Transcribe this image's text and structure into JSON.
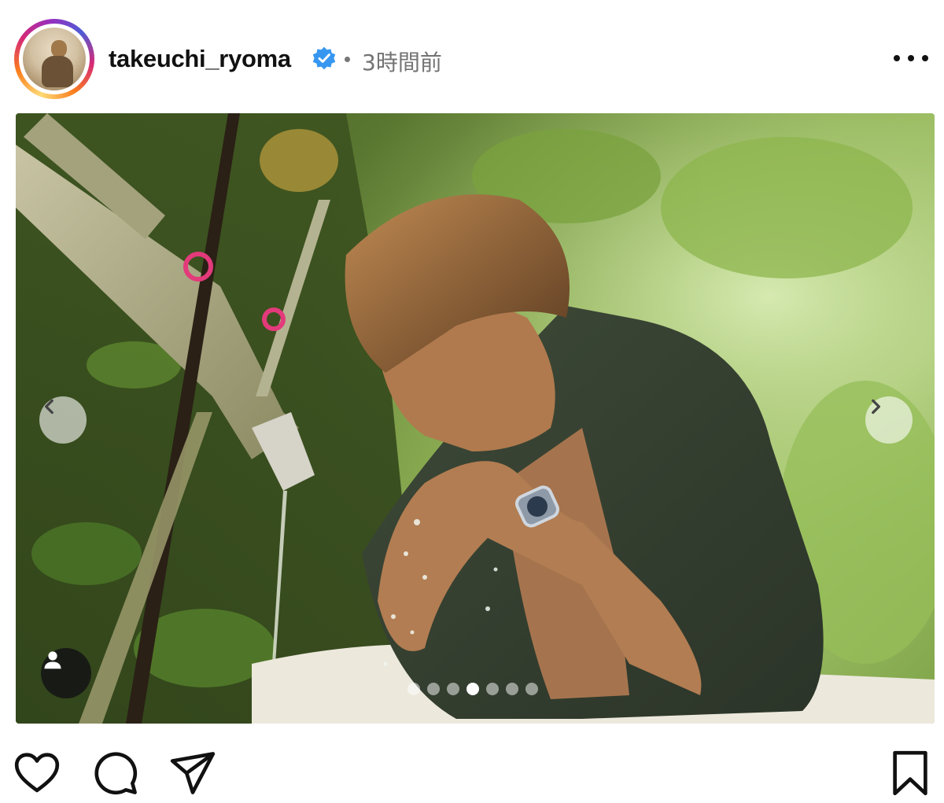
{
  "post": {
    "author": {
      "username": "takeuchi_ryoma",
      "verified": true,
      "verified_color": "#3797f0",
      "avatar_icon": "profile-avatar"
    },
    "timestamp": "3時間前",
    "more_icon": "ellipsis-icon"
  },
  "media": {
    "description_icon": "photo",
    "carousel": {
      "total_slides": 7,
      "current_slide": 4
    },
    "prev_icon": "chevron-left-icon",
    "next_icon": "chevron-right-icon",
    "tag_icon": "user-tag-icon"
  },
  "actions": {
    "like_icon": "heart-icon",
    "comment_icon": "comment-icon",
    "share_icon": "share-icon",
    "save_icon": "bookmark-icon"
  },
  "colors": {
    "ring_gradient": [
      "#feda75",
      "#fa7e1e",
      "#d62976",
      "#962fbf",
      "#4f5bd5"
    ],
    "timestamp": "#737373",
    "icon": "#111111"
  }
}
